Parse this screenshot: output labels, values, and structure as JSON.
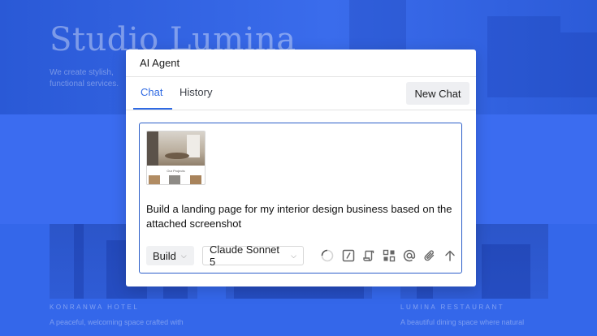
{
  "background": {
    "hero_title": "Studio Lumina",
    "hero_subtitle": "We create stylish, functional services.",
    "cards": [
      {
        "name": "KONRANWA HOTEL",
        "description": "A peaceful, welcoming space crafted with"
      },
      {
        "name": "LUMINA RESTAURANT",
        "description": "A beautiful dining space where natural"
      }
    ]
  },
  "dialog": {
    "title": "AI Agent",
    "tabs": [
      {
        "label": "Chat",
        "active": true
      },
      {
        "label": "History",
        "active": false
      }
    ],
    "new_chat_label": "New Chat",
    "attachment": {
      "caption": "Our Projects"
    },
    "prompt": "Build a landing page for my interior design business based on the attached screenshot",
    "mode_select": "Build",
    "model_select": "Claude Sonnet 5",
    "toolbar_icons": [
      "loading-icon",
      "slash-command-icon",
      "document-icon",
      "components-icon",
      "mention-icon",
      "attach-icon",
      "send-icon"
    ]
  },
  "colors": {
    "accent": "#2f6ae3",
    "background_overlay": "#3467ea"
  }
}
